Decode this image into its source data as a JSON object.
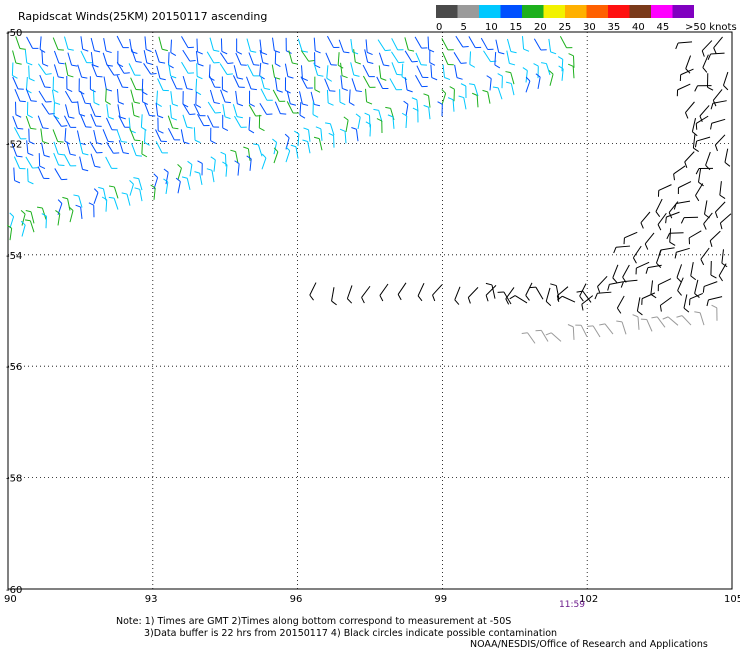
{
  "title": "Rapidscat Winds(25KM) 20150117 ascending",
  "legend": {
    "swatches": [
      {
        "label": "0",
        "color": "#4a4a4a"
      },
      {
        "label": "5",
        "color": "#9a9a9a"
      },
      {
        "label": "10",
        "color": "#00c8ff"
      },
      {
        "label": "15",
        "color": "#0050ff"
      },
      {
        "label": "20",
        "color": "#1db01d"
      },
      {
        "label": "25",
        "color": "#f2f200"
      },
      {
        "label": "30",
        "color": "#ffb000"
      },
      {
        "label": "35",
        "color": "#ff6000"
      },
      {
        "label": "40",
        "color": "#ff1010"
      },
      {
        "label": "45",
        "color": "#7a3a1a"
      },
      {
        "label": "",
        "color": "#ff00ff"
      },
      {
        "label": "",
        "color": "#8000c0"
      }
    ],
    "labels": [
      "0",
      "5",
      "10",
      "15",
      "20",
      "25",
      "30",
      "35",
      "40",
      "45",
      ">50 knots"
    ]
  },
  "axes": {
    "lon_ticks": [
      "90",
      "93",
      "96",
      "99",
      "102",
      "105"
    ],
    "lat_ticks": [
      "-50",
      "-52",
      "-54",
      "-56",
      "-58",
      "-60"
    ],
    "lon_range": [
      90,
      105
    ],
    "lat_range": [
      -60,
      -50
    ]
  },
  "pass_time": "11:59",
  "notes": [
    "Note: 1) Times are GMT 2)Times along bottom correspond to measurement at -50S",
    "3)Data buffer is 22 hrs from 20150117 4) Black circles indicate possible contamination",
    "NOAA/NESDIS/Office of Research and Applications"
  ],
  "swaths": [
    {
      "name": "main-swath",
      "lon_range": [
        90,
        102
      ],
      "lat_range": [
        -53.2,
        -50
      ],
      "colors": [
        "#0050ff",
        "#00c8ff",
        "#1db01d"
      ]
    },
    {
      "name": "southern-strip",
      "lon_range": [
        90,
        101.8
      ],
      "lat_range": [
        -54.1,
        -50.7
      ],
      "colors": [
        "#00c8ff",
        "#1db01d",
        "#0050ff"
      ]
    },
    {
      "name": "east-swath",
      "lon_range": [
        100,
        105
      ],
      "lat_range": [
        -56,
        -50
      ],
      "colors": [
        "#000000",
        "#9a9a9a"
      ]
    }
  ]
}
